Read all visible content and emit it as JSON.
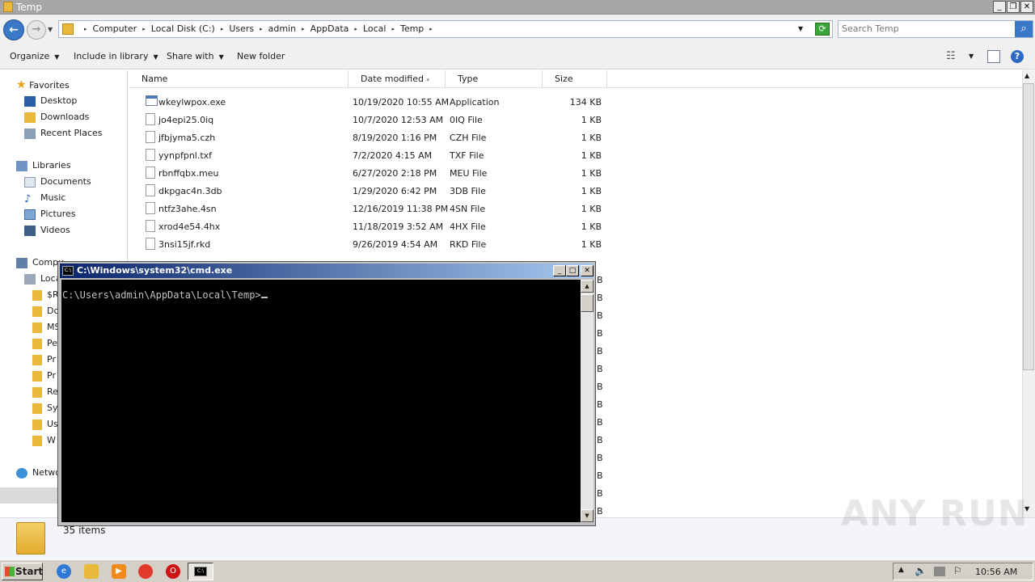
{
  "window": {
    "title": "Temp"
  },
  "address": {
    "crumbs": [
      "Computer",
      "Local Disk (C:)",
      "Users",
      "admin",
      "AppData",
      "Local",
      "Temp"
    ]
  },
  "search": {
    "placeholder": "Search Temp"
  },
  "toolbar": {
    "organize": "Organize",
    "include": "Include in library",
    "share": "Share with",
    "new_folder": "New folder"
  },
  "nav": {
    "favorites": "Favorites",
    "desktop": "Desktop",
    "downloads": "Downloads",
    "recent": "Recent Places",
    "libraries": "Libraries",
    "documents": "Documents",
    "music": "Music",
    "pictures": "Pictures",
    "videos": "Videos",
    "computer": "Compu",
    "local": "Loca",
    "sub": [
      "$R",
      "Do",
      "MS",
      "Pe",
      "Pr",
      "Pr",
      "Re",
      "Sy",
      "Us",
      "W"
    ],
    "network": "Netwo"
  },
  "columns": {
    "name": "Name",
    "date": "Date modified",
    "type": "Type",
    "size": "Size"
  },
  "files": [
    {
      "name": "wkeylwpox.exe",
      "date": "10/19/2020 10:55 AM",
      "type": "Application",
      "size": "134 KB",
      "icon": "exe"
    },
    {
      "name": "jo4epi25.0iq",
      "date": "10/7/2020 12:53 AM",
      "type": "0IQ File",
      "size": "1 KB",
      "icon": "file"
    },
    {
      "name": "jfbjyma5.czh",
      "date": "8/19/2020 1:16 PM",
      "type": "CZH File",
      "size": "1 KB",
      "icon": "file"
    },
    {
      "name": "yynpfpnl.txf",
      "date": "7/2/2020 4:15 AM",
      "type": "TXF File",
      "size": "1 KB",
      "icon": "file"
    },
    {
      "name": "rbnffqbx.meu",
      "date": "6/27/2020 2:18 PM",
      "type": "MEU File",
      "size": "1 KB",
      "icon": "file"
    },
    {
      "name": "dkpgac4n.3db",
      "date": "1/29/2020 6:42 PM",
      "type": "3DB File",
      "size": "1 KB",
      "icon": "file"
    },
    {
      "name": "ntfz3ahe.4sn",
      "date": "12/16/2019 11:38 PM",
      "type": "4SN File",
      "size": "1 KB",
      "icon": "file"
    },
    {
      "name": "xrod4e54.4hx",
      "date": "11/18/2019 3:52 AM",
      "type": "4HX File",
      "size": "1 KB",
      "icon": "file"
    },
    {
      "name": "3nsi15jf.rkd",
      "date": "9/26/2019 4:54 AM",
      "type": "RKD File",
      "size": "1 KB",
      "icon": "file"
    }
  ],
  "hidden_size_fragment": "B",
  "status": {
    "items": "35 items"
  },
  "cmd": {
    "title": "C:\\Windows\\system32\\cmd.exe",
    "prompt": "C:\\Users\\admin\\AppData\\Local\\Temp>"
  },
  "taskbar": {
    "start": "Start",
    "clock": "10:56 AM"
  },
  "watermark": "ANY RUN"
}
